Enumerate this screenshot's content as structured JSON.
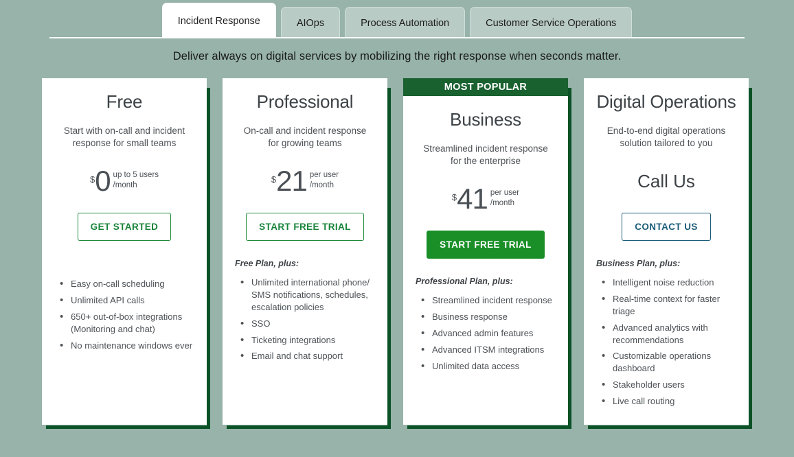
{
  "tabs": [
    {
      "label": "Incident Response",
      "active": true
    },
    {
      "label": "AIOps",
      "active": false
    },
    {
      "label": "Process Automation",
      "active": false
    },
    {
      "label": "Customer Service Operations",
      "active": false
    }
  ],
  "tagline": "Deliver always on digital services by mobilizing the right response when seconds matter.",
  "colors": {
    "page_background": "#97b3aa",
    "accent_dark_green": "#0b5226",
    "banner_green": "#1a6130",
    "button_solid_green": "#1a8f28",
    "button_outline_green": "#17833a",
    "button_teal": "#1b5c7a"
  },
  "plans": [
    {
      "name": "Free",
      "description": "Start with on-call and incident response for small teams",
      "banner": null,
      "currency": "$",
      "amount": "0",
      "per_line1": "up to 5 users",
      "per_line2": "/month",
      "call_us": null,
      "cta_label": "GET STARTED",
      "cta_style": "outline-green",
      "plus_label": null,
      "features": [
        "Easy on-call scheduling",
        "Unlimited API calls",
        "650+ out-of-box integrations (Monitoring and chat)",
        "No maintenance windows ever"
      ]
    },
    {
      "name": "Professional",
      "description": "On-call and incident response for growing teams",
      "banner": null,
      "currency": "$",
      "amount": "21",
      "per_line1": "per user",
      "per_line2": "/month",
      "call_us": null,
      "cta_label": "START FREE TRIAL",
      "cta_style": "outline-green",
      "plus_label": "Free Plan, plus:",
      "features": [
        "Unlimited international phone/ SMS notifications, schedules, escalation policies",
        "SSO",
        "Ticketing integrations",
        "Email and chat support"
      ]
    },
    {
      "name": "Business",
      "description": "Streamlined incident response for the enterprise",
      "banner": "MOST POPULAR",
      "currency": "$",
      "amount": "41",
      "per_line1": "per user",
      "per_line2": "/month",
      "call_us": null,
      "cta_label": "START FREE TRIAL",
      "cta_style": "solid-green",
      "plus_label": "Professional Plan, plus:",
      "features": [
        "Streamlined incident response",
        "Business response",
        "Advanced admin features",
        "Advanced ITSM integrations",
        "Unlimited data access"
      ]
    },
    {
      "name": "Digital Operations",
      "description": "End-to-end digital operations solution tailored to you",
      "banner": null,
      "currency": null,
      "amount": null,
      "per_line1": null,
      "per_line2": null,
      "call_us": "Call Us",
      "cta_label": "CONTACT US",
      "cta_style": "outline-teal",
      "plus_label": "Business Plan, plus:",
      "features": [
        "Intelligent noise reduction",
        "Real-time context for faster triage",
        "Advanced analytics with recommendations",
        "Customizable operations dashboard",
        "Stakeholder users",
        "Live call routing"
      ]
    }
  ]
}
